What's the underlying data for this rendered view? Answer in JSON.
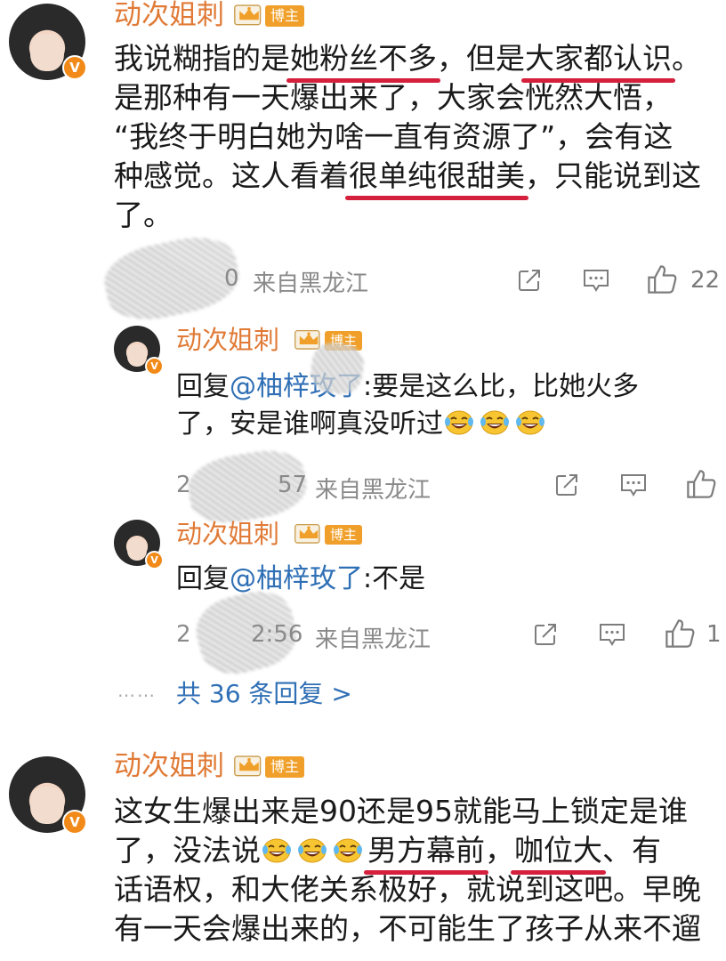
{
  "badges": {
    "verified": "V",
    "blogger": "博主"
  },
  "comments": [
    {
      "author": "动次姐刺",
      "lines": [
        [
          "我说糊指的是",
          "她粉丝不多",
          "，但是",
          "大家都认识",
          "。"
        ],
        [
          "是那种有一天爆出来了，大家会恍然大悟，"
        ],
        [
          "“我终于明白她为啥一直有资源了”，会有这"
        ],
        [
          "种感觉。这人看着",
          "很单纯很甜美",
          "，只能说到这"
        ],
        [
          "了。"
        ]
      ],
      "time_tail": "0",
      "location": "来自黑龙江",
      "likes": "22"
    },
    {
      "author": "动次姐刺",
      "reply_prefix": "回复",
      "reply_to": "@柚梓玫了",
      "lines": [
        [
          ":要是这么比，比她火多"
        ],
        [
          "了，安是谁啊真没听过"
        ]
      ],
      "time_head": "2",
      "time_tail": "57",
      "location": "来自黑龙江",
      "likes": ""
    },
    {
      "author": "动次姐刺",
      "reply_prefix": "回复",
      "reply_to": "@柚梓玫了",
      "lines": [
        [
          ":不是"
        ]
      ],
      "time_head": "2",
      "time_tail": "2:56",
      "location": "来自黑龙江",
      "likes": "1"
    },
    {
      "author": "动次姐刺",
      "lines": [
        [
          "这女生爆出来是90还是95就能马上锁定是谁"
        ],
        [
          "了，没法说",
          "男方幕前",
          "，",
          "咖位大",
          "、有"
        ],
        [
          "话语权，和大佬关系极好，就说到这吧。早晚"
        ],
        [
          "有一天会爆出来的，不可能生了孩子从来不遛"
        ]
      ]
    }
  ],
  "more_replies": {
    "dots": "……",
    "label": "共 36 条回复 >"
  },
  "icons": [
    "share-icon",
    "comment-icon",
    "like-icon",
    "laugh-cry-emoji"
  ],
  "colors": {
    "name": "#e07a36",
    "underline": "#d4203c",
    "mention": "#2f6fb5",
    "meta": "#8a8a8a"
  }
}
